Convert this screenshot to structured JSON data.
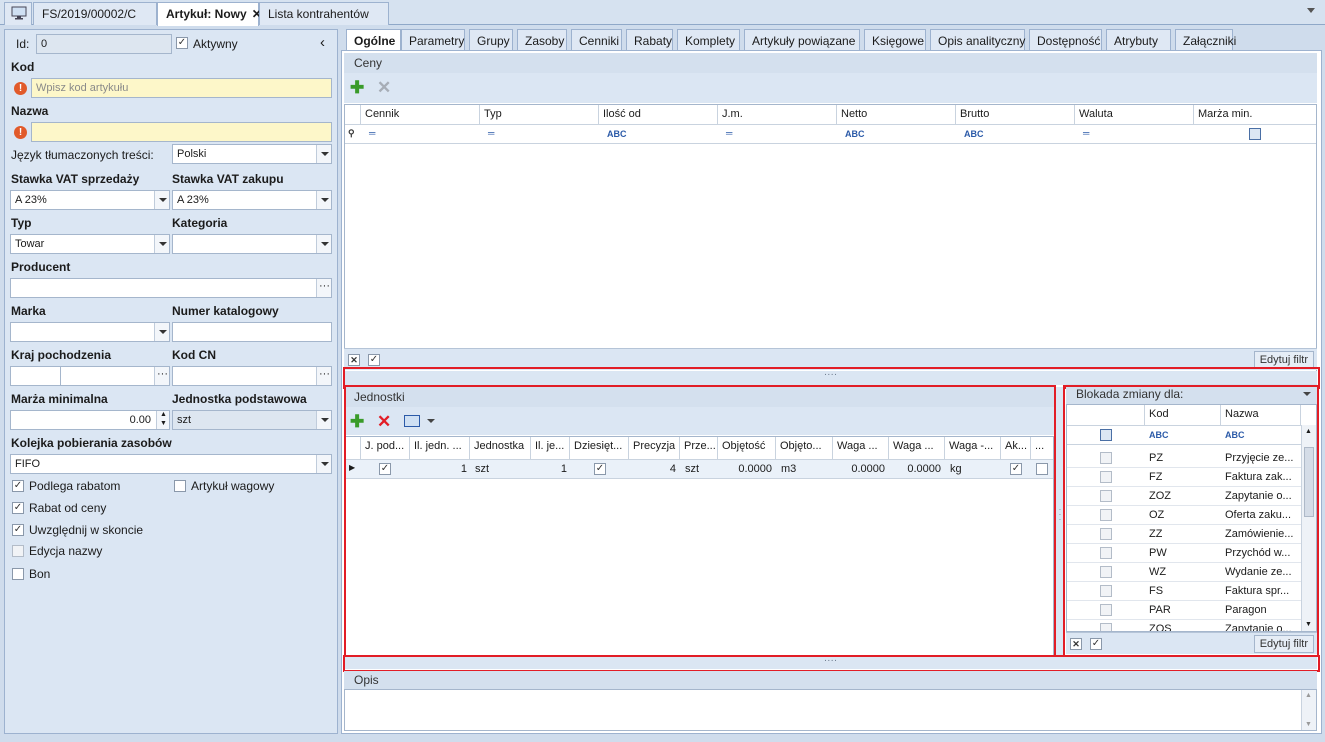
{
  "doc_tabs": [
    {
      "label": "FS/2019/00002/C",
      "active": false
    },
    {
      "label": "Artykuł: Nowy",
      "active": true
    },
    {
      "label": "Lista kontrahentów",
      "active": false
    }
  ],
  "left": {
    "id_label": "Id:",
    "id_value": "0",
    "active_label": "Aktywny",
    "collapse_glyph": "‹",
    "kod_label": "Kod",
    "kod_placeholder": "Wpisz kod artykułu",
    "nazwa_label": "Nazwa",
    "nazwa_value": "",
    "jezyk_label": "Język tłumaczonych treści:",
    "jezyk_value": "Polski",
    "vat_sprz_label": "Stawka VAT sprzedaży",
    "vat_sprz_value": "A 23%",
    "vat_zak_label": "Stawka VAT zakupu",
    "vat_zak_value": "A 23%",
    "typ_label": "Typ",
    "typ_value": "Towar",
    "kategoria_label": "Kategoria",
    "kategoria_value": "",
    "producent_label": "Producent",
    "producent_value": "",
    "marka_label": "Marka",
    "marka_value": "",
    "numer_label": "Numer katalogowy",
    "numer_value": "",
    "kraj_label": "Kraj pochodzenia",
    "kodcn_label": "Kod CN",
    "marza_label": "Marża minimalna",
    "marza_value": "0.00",
    "jedn_label": "Jednostka podstawowa",
    "jedn_value": "szt",
    "kolejka_label": "Kolejka pobierania zasobów",
    "kolejka_value": "FIFO",
    "checks": [
      {
        "label": "Podlega rabatom",
        "checked": true
      },
      {
        "label": "Artykuł wagowy",
        "checked": false
      },
      {
        "label": "Rabat od ceny",
        "checked": true
      },
      {
        "label": "Uwzględnij w skoncie",
        "checked": true
      },
      {
        "label": "Edycja nazwy",
        "checked": false
      },
      {
        "label": "Bon",
        "checked": false
      }
    ]
  },
  "inner_tabs": [
    "Ogólne",
    "Parametry",
    "Grupy",
    "Zasoby",
    "Cenniki",
    "Rabaty",
    "Komplety",
    "Artykuły powiązane",
    "Księgowe",
    "Opis analityczny",
    "Dostępność",
    "Atrybuty",
    "Załączniki"
  ],
  "ceny": {
    "title": "Ceny",
    "columns": [
      "Cennik",
      "Typ",
      "Ilość od",
      "J.m.",
      "Netto",
      "Brutto",
      "Waluta",
      "Marża min."
    ],
    "edit_filter": "Edytuj filtr"
  },
  "jednostki": {
    "title": "Jednostki",
    "columns": [
      "J. pod...",
      "Il. jedn. ...",
      "Jednostka",
      "Il. je...",
      "Dziesięt...",
      "Precyzja",
      "Prze...",
      "Objętość",
      "Objęto...",
      "Waga ...",
      "Waga ...",
      "Waga -...",
      "Ak...",
      "..."
    ],
    "row": {
      "il_jedn": "1",
      "jednostka": "szt",
      "il_je": "1",
      "precyzja": "4",
      "prze": "szt",
      "objetosc": "0.0000",
      "objeto": "m3",
      "waga1": "0.0000",
      "waga2": "0.0000",
      "waga3": "kg"
    }
  },
  "blokada": {
    "title": "Blokada zmiany dla:",
    "columns": [
      "Kod",
      "Nazwa"
    ],
    "rows": [
      {
        "kod": "PZ",
        "nazwa": "Przyjęcie ze..."
      },
      {
        "kod": "FZ",
        "nazwa": "Faktura zak..."
      },
      {
        "kod": "ZOZ",
        "nazwa": "Zapytanie o..."
      },
      {
        "kod": "OZ",
        "nazwa": "Oferta zaku..."
      },
      {
        "kod": "ZZ",
        "nazwa": "Zamówienie..."
      },
      {
        "kod": "PW",
        "nazwa": "Przychód w..."
      },
      {
        "kod": "WZ",
        "nazwa": "Wydanie ze..."
      },
      {
        "kod": "FS",
        "nazwa": "Faktura spr..."
      },
      {
        "kod": "PAR",
        "nazwa": "Paragon"
      },
      {
        "kod": "ZOS",
        "nazwa": "Zapytanie o..."
      }
    ],
    "edit_filter": "Edytuj filtr"
  },
  "opis": {
    "title": "Opis"
  },
  "colors": {
    "accent_red": "#e21d26",
    "required_bg": "#fdf7c9",
    "panel_bg": "#dbe6f3"
  }
}
